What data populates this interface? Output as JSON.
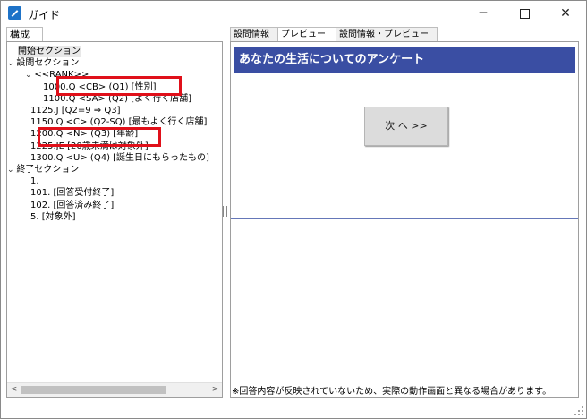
{
  "window": {
    "title": "ガイド",
    "minimize_glyph": "─",
    "close_glyph": "✕"
  },
  "left": {
    "tab_label": "構成",
    "tree": [
      {
        "text": "開始セクション",
        "indent": 0,
        "chevron": false,
        "selected": true
      },
      {
        "text": "設問セクション",
        "indent": 0,
        "chevron": true
      },
      {
        "text": "<<RANK>>",
        "indent": 1,
        "chevron": true
      },
      {
        "text": "1000.Q <CB> (Q1) [性別]",
        "indent": 2,
        "chevron": false
      },
      {
        "text": "1100.Q <SA> (Q2) [よく行く店舗]",
        "indent": 2,
        "chevron": false
      },
      {
        "text": "1125.J  [Q2=9 ⇒  Q3]",
        "indent": 1,
        "chevron": false
      },
      {
        "text": "1150.Q <C> (Q2-SQ) [最もよく行く店舗]",
        "indent": 1,
        "chevron": false
      },
      {
        "text": "1200.Q <N> (Q3) [年齢]",
        "indent": 1,
        "chevron": false
      },
      {
        "text": "1225.JE  [20歳未満は対象外]",
        "indent": 1,
        "chevron": false
      },
      {
        "text": "1300.Q <U> (Q4) [誕生日にもらったもの]",
        "indent": 1,
        "chevron": false
      },
      {
        "text": "終了セクション",
        "indent": 0,
        "chevron": true
      },
      {
        "text": "1.",
        "indent": 1,
        "chevron": false
      },
      {
        "text": "101. [回答受付終了]",
        "indent": 1,
        "chevron": false
      },
      {
        "text": "102. [回答済み終了]",
        "indent": 1,
        "chevron": false
      },
      {
        "text": "5. [対象外]",
        "indent": 1,
        "chevron": false
      }
    ],
    "scroll_left_glyph": "<",
    "scroll_right_glyph": ">"
  },
  "right": {
    "tabs": [
      {
        "label": "設問情報",
        "active": false
      },
      {
        "label": "プレビュー",
        "active": true
      },
      {
        "label": "設問情報・プレビュー",
        "active": false
      }
    ],
    "preview": {
      "header": "あなたの生活についてのアンケート",
      "next_button": "次 へ >>",
      "note": "※回答内容が反映されていないため、実際の動作画面と異なる場合があります。"
    }
  },
  "colors": {
    "header_bg": "#3a4ea3",
    "highlight": "#e0101a"
  }
}
